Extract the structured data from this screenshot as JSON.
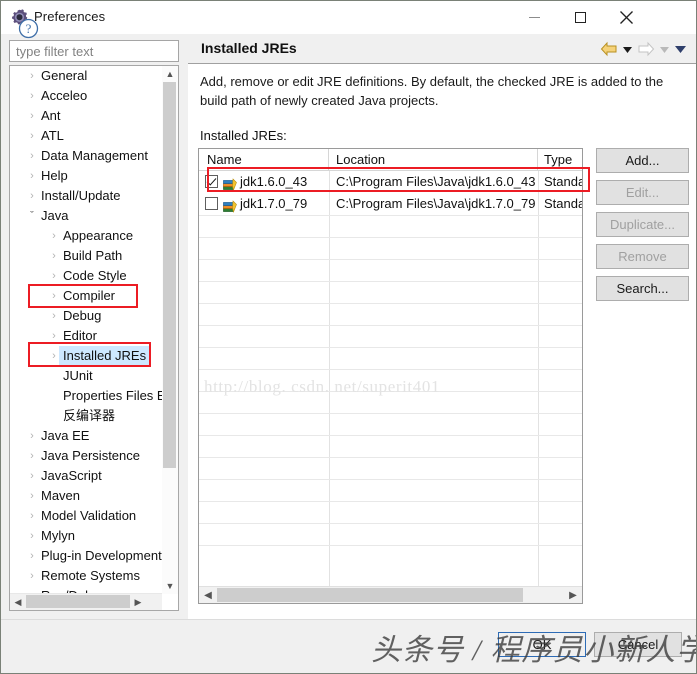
{
  "window": {
    "title": "Preferences",
    "icon": "gear-icon",
    "minimize": "minimize-icon",
    "maximize": "maximize-icon",
    "close": "close-icon"
  },
  "filter": {
    "placeholder": "type filter text",
    "value": ""
  },
  "tree": {
    "items": [
      {
        "label": "General",
        "level": 0,
        "arrow": "›",
        "expanded": false,
        "selected": false
      },
      {
        "label": "Acceleo",
        "level": 0,
        "arrow": "›",
        "expanded": false,
        "selected": false
      },
      {
        "label": "Ant",
        "level": 0,
        "arrow": "›",
        "expanded": false,
        "selected": false
      },
      {
        "label": "ATL",
        "level": 0,
        "arrow": "›",
        "expanded": false,
        "selected": false
      },
      {
        "label": "Data Management",
        "level": 0,
        "arrow": "›",
        "expanded": false,
        "selected": false
      },
      {
        "label": "Help",
        "level": 0,
        "arrow": "›",
        "expanded": false,
        "selected": false
      },
      {
        "label": "Install/Update",
        "level": 0,
        "arrow": "›",
        "expanded": false,
        "selected": false
      },
      {
        "label": "Java",
        "level": 0,
        "arrow": "ˇ",
        "expanded": true,
        "selected": false
      },
      {
        "label": "Appearance",
        "level": 1,
        "arrow": "›",
        "expanded": false,
        "selected": false
      },
      {
        "label": "Build Path",
        "level": 1,
        "arrow": "›",
        "expanded": false,
        "selected": false
      },
      {
        "label": "Code Style",
        "level": 1,
        "arrow": "›",
        "expanded": false,
        "selected": false
      },
      {
        "label": "Compiler",
        "level": 1,
        "arrow": "›",
        "expanded": false,
        "selected": false
      },
      {
        "label": "Debug",
        "level": 1,
        "arrow": "›",
        "expanded": false,
        "selected": false
      },
      {
        "label": "Editor",
        "level": 1,
        "arrow": "›",
        "expanded": false,
        "selected": false
      },
      {
        "label": "Installed JREs",
        "level": 1,
        "arrow": "›",
        "expanded": false,
        "selected": true
      },
      {
        "label": "JUnit",
        "level": 1,
        "arrow": "",
        "expanded": false,
        "selected": false
      },
      {
        "label": "Properties Files Ed",
        "level": 1,
        "arrow": "",
        "expanded": false,
        "selected": false
      },
      {
        "label": "反编译器",
        "level": 1,
        "arrow": "",
        "expanded": false,
        "selected": false
      },
      {
        "label": "Java EE",
        "level": 0,
        "arrow": "›",
        "expanded": false,
        "selected": false
      },
      {
        "label": "Java Persistence",
        "level": 0,
        "arrow": "›",
        "expanded": false,
        "selected": false
      },
      {
        "label": "JavaScript",
        "level": 0,
        "arrow": "›",
        "expanded": false,
        "selected": false
      },
      {
        "label": "Maven",
        "level": 0,
        "arrow": "›",
        "expanded": false,
        "selected": false
      },
      {
        "label": "Model Validation",
        "level": 0,
        "arrow": "›",
        "expanded": false,
        "selected": false
      },
      {
        "label": "Mylyn",
        "level": 0,
        "arrow": "›",
        "expanded": false,
        "selected": false
      },
      {
        "label": "Plug-in Development",
        "level": 0,
        "arrow": "›",
        "expanded": false,
        "selected": false
      },
      {
        "label": "Remote Systems",
        "level": 0,
        "arrow": "›",
        "expanded": false,
        "selected": false
      },
      {
        "label": "Run/Debug",
        "level": 0,
        "arrow": "›",
        "expanded": false,
        "selected": false
      }
    ]
  },
  "page": {
    "title": "Installed JREs",
    "description": "Add, remove or edit JRE definitions. By default, the checked JRE is added to the build path of newly created Java projects.",
    "table_label": "Installed JREs:",
    "nav": {
      "back": "back-arrow-icon",
      "back_menu": "chevron-down-icon",
      "forward": "forward-arrow-icon",
      "forward_menu": "chevron-down-icon",
      "more_menu": "chevron-down-icon"
    }
  },
  "table": {
    "columns": [
      "Name",
      "Location",
      "Type"
    ],
    "rows": [
      {
        "checked": true,
        "name": "jdk1.6.0_43",
        "location": "C:\\Program Files\\Java\\jdk1.6.0_43",
        "type": "Standa",
        "icon": "jre-books-icon"
      },
      {
        "checked": false,
        "name": "jdk1.7.0_79",
        "location": "C:\\Program Files\\Java\\jdk1.7.0_79",
        "type": "Standa",
        "icon": "jre-books-icon"
      }
    ],
    "watermark": "http://blog. csdn. net/superit401"
  },
  "buttons": {
    "add": "Add...",
    "edit": "Edit...",
    "duplicate": "Duplicate...",
    "remove": "Remove",
    "search": "Search..."
  },
  "footer": {
    "help": "help-icon",
    "ok": "OK",
    "cancel": "Cancel",
    "watermark": "头条号 / 程序员小新人学习"
  },
  "colors": {
    "selection": "#cde8ff",
    "annotation": "#ec1c24",
    "focus_border": "#2d6bb5",
    "header_bg": "#f0f0f0"
  }
}
